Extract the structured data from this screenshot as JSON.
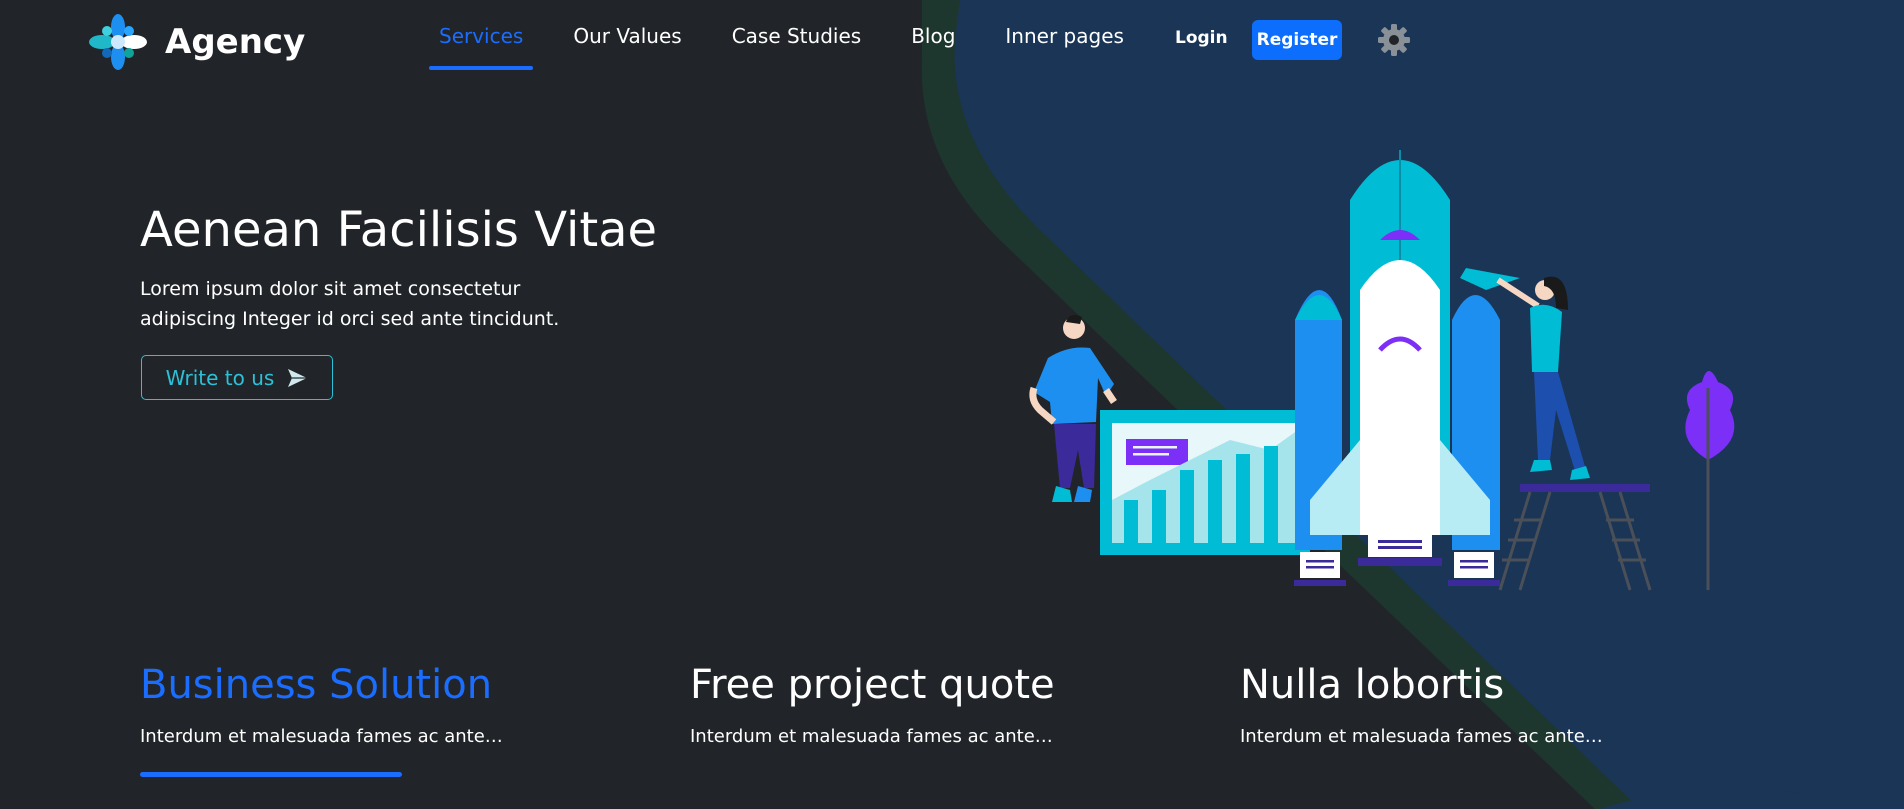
{
  "brand": {
    "name": "Agency",
    "logo_icon": "flower-logo-icon"
  },
  "nav": {
    "items": [
      {
        "label": "Services",
        "active": true
      },
      {
        "label": "Our Values",
        "active": false
      },
      {
        "label": "Case Studies",
        "active": false
      },
      {
        "label": "Blog",
        "active": false
      },
      {
        "label": "Inner pages",
        "active": false
      }
    ],
    "login_label": "Login",
    "register_label": "Register",
    "settings_icon": "gear-icon"
  },
  "hero": {
    "title": "Aenean Facilisis Vitae",
    "text": "Lorem ipsum dolor sit amet consectetur adipiscing Integer id orci sed ante tincidunt.",
    "cta_label": "Write to us",
    "cta_icon": "send-icon",
    "illustration": "rocket-launch-illustration"
  },
  "features": [
    {
      "title": "Business Solution",
      "text": "Interdum et malesuada fames ac ante…",
      "active": true
    },
    {
      "title": "Free project quote",
      "text": "Interdum et malesuada fames ac ante…",
      "active": false
    },
    {
      "title": "Nulla lobortis",
      "text": "Interdum et malesuada fames ac ante…",
      "active": false
    }
  ],
  "colors": {
    "background": "#212529",
    "accent": "#1a6dff",
    "register_bg": "#0d6efd",
    "cta_outline": "#2cc1d8",
    "panel": "#19365a"
  }
}
